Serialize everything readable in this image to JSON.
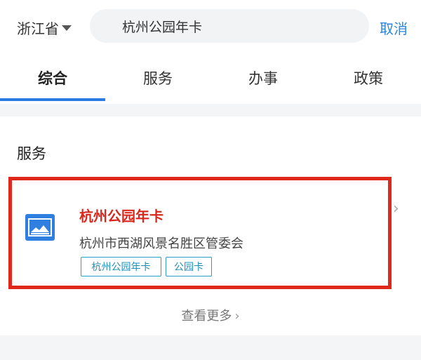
{
  "header": {
    "province": "浙江省",
    "search_value": "杭州公园年卡",
    "cancel_label": "取消"
  },
  "tabs": [
    {
      "label": "综合",
      "active": true
    },
    {
      "label": "服务",
      "active": false
    },
    {
      "label": "办事",
      "active": false
    },
    {
      "label": "政策",
      "active": false
    }
  ],
  "section": {
    "title": "服务",
    "card": {
      "title": "杭州公园年卡",
      "subtitle": "杭州市西湖风景名胜区管委会",
      "tags": [
        "杭州公园年卡",
        "公园卡"
      ]
    },
    "more_label": "查看更多"
  },
  "colors": {
    "accent": "#2a86e0",
    "highlight_border": "#e0271c",
    "card_title": "#d8281e",
    "tag": "#1f8fb8"
  }
}
